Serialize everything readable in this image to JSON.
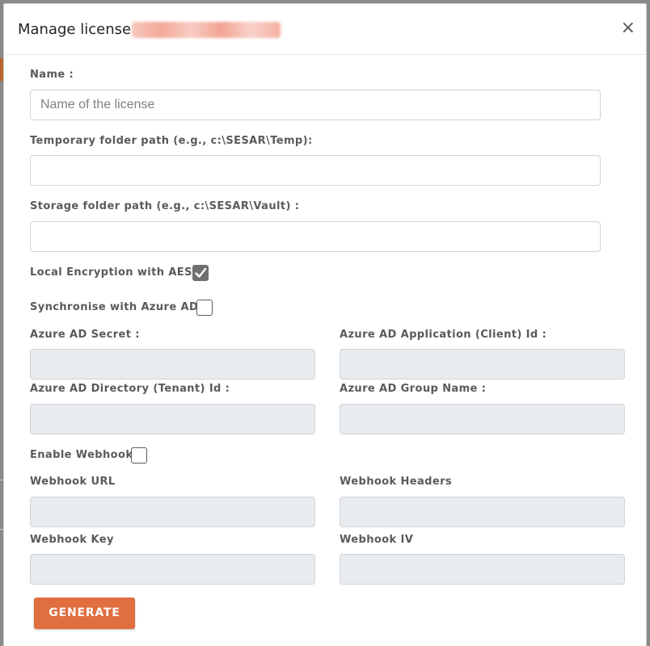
{
  "modal": {
    "title": "Manage license :",
    "close_symbol": "×"
  },
  "form": {
    "name_label": "Name :",
    "name_placeholder": "Name of the license",
    "name_value": "",
    "temp_label": "Temporary folder path (e.g., c:\\SESAR\\Temp):",
    "temp_value": "",
    "storage_label": "Storage folder path (e.g., c:\\SESAR\\Vault) :",
    "storage_value": "",
    "encryption_label": "Local Encryption with AES :",
    "encryption_checked": true,
    "sync_label": "Synchronise with Azure AD :",
    "sync_checked": false,
    "azure_secret_label": "Azure AD Secret :",
    "azure_app_id_label": "Azure AD Application (Client) Id :",
    "azure_tenant_label": "Azure AD Directory (Tenant) Id :",
    "azure_group_label": "Azure AD Group Name :",
    "webhook_enable_label": "Enable Webhook",
    "webhook_checked": false,
    "webhook_url_label": "Webhook URL",
    "webhook_headers_label": "Webhook Headers",
    "webhook_key_label": "Webhook Key",
    "webhook_iv_label": "Webhook IV",
    "generate_label": "GENERATE"
  },
  "colors": {
    "accent": "#e06e3f",
    "disabled_input": "#e9ecef",
    "label_text": "#5a5a5a"
  },
  "icons": {
    "close": "close-icon",
    "check": "checkmark-icon"
  }
}
